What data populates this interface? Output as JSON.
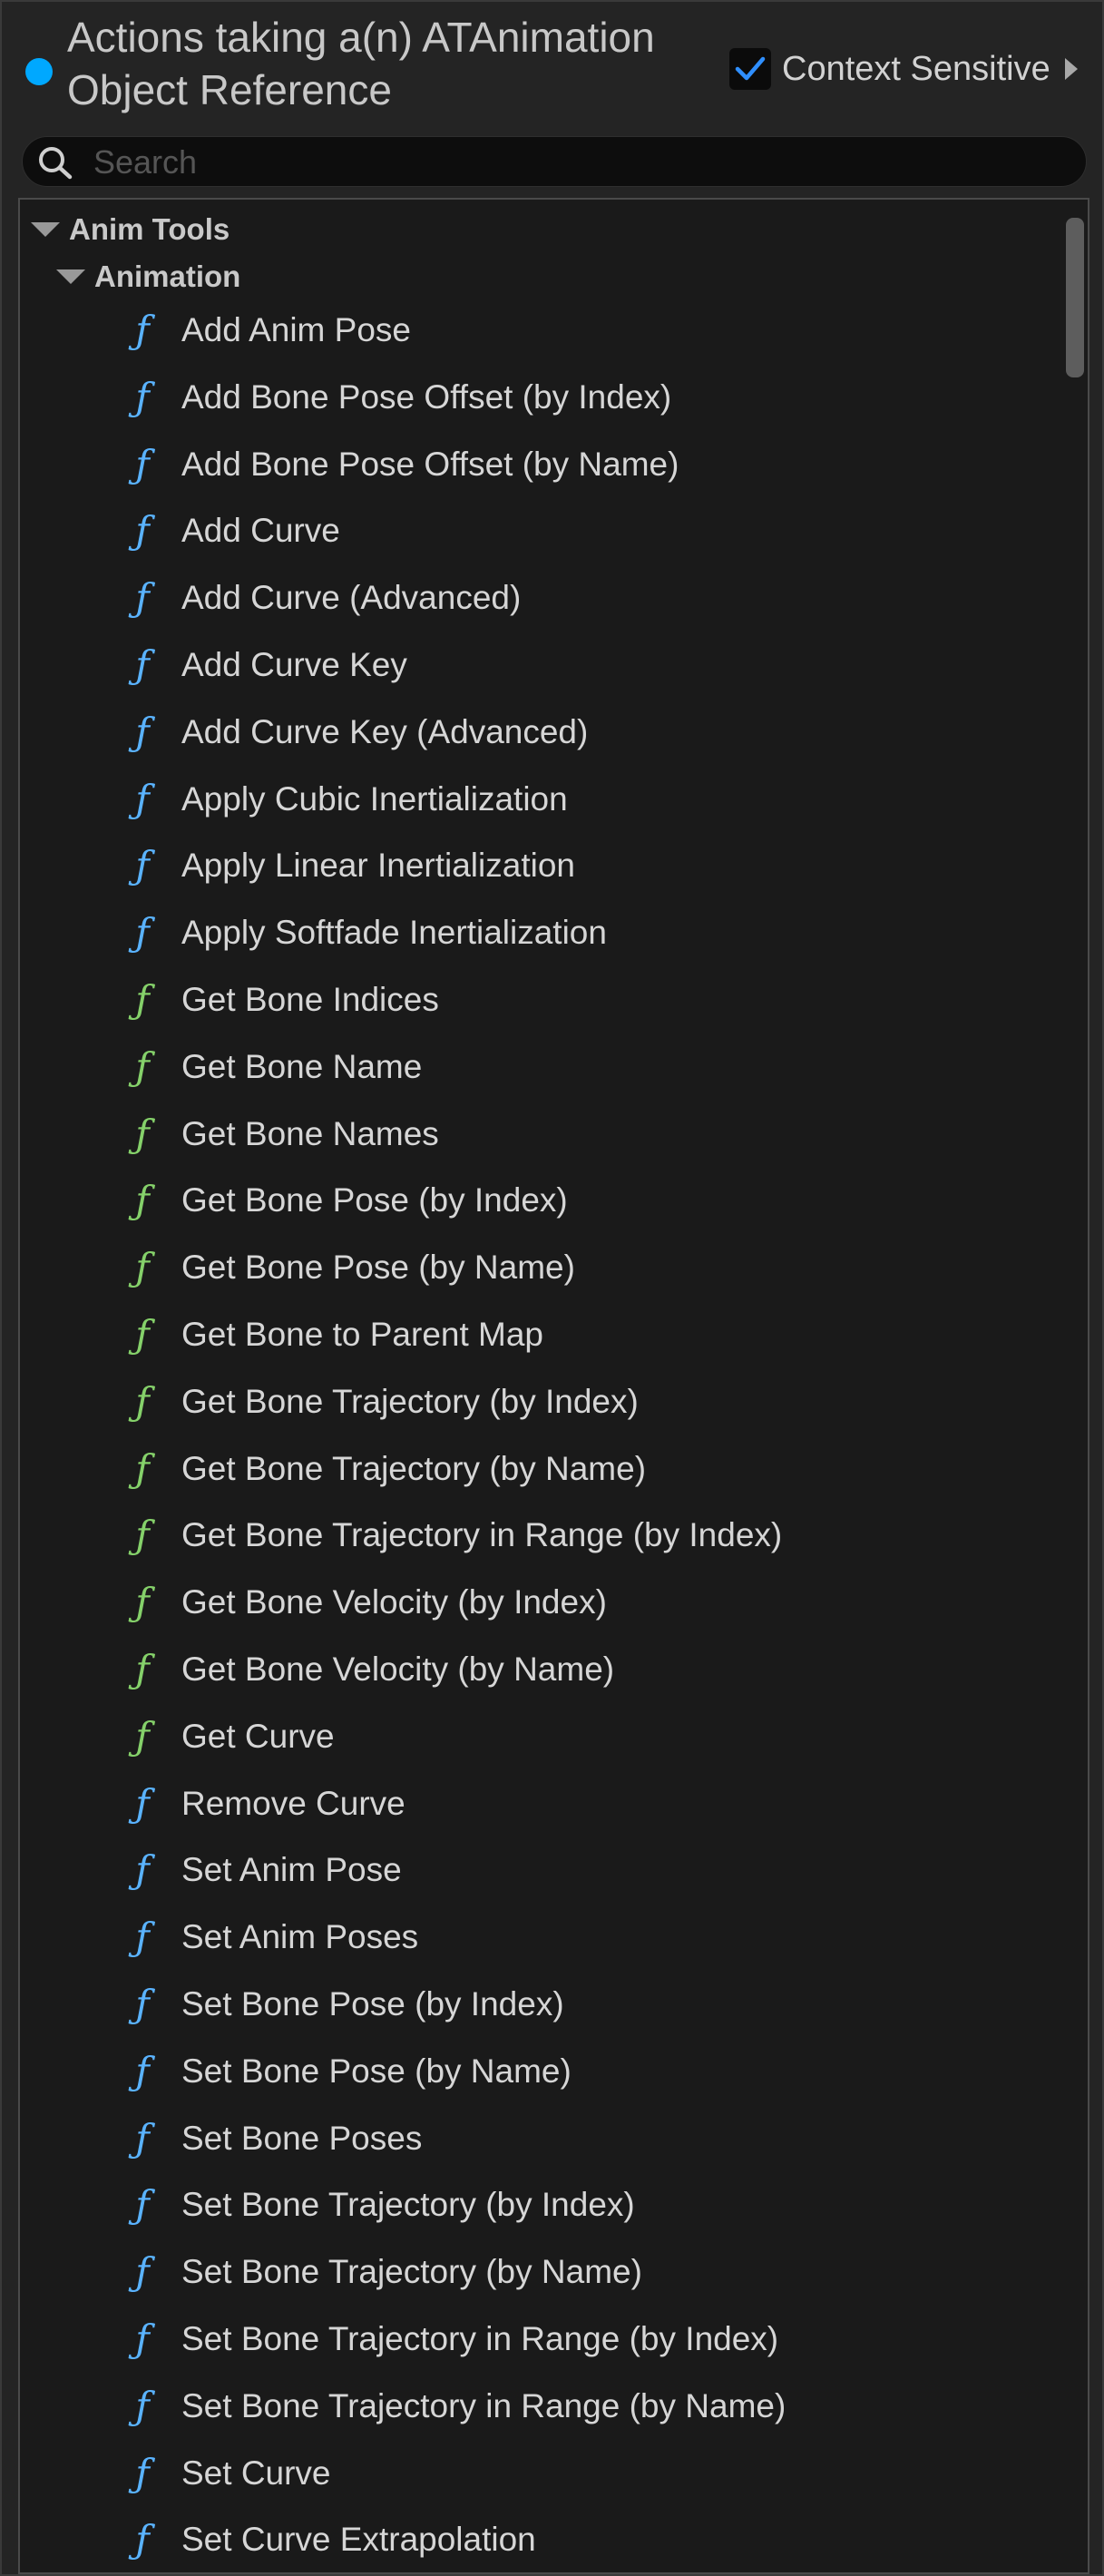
{
  "header": {
    "title_line1": "Actions taking a(n) ATAnimation",
    "title_line2": "Object Reference",
    "context_label": "Context Sensitive",
    "context_checked": true
  },
  "search": {
    "placeholder": "Search",
    "value": ""
  },
  "tree": {
    "root_label": "Anim Tools",
    "sub_label": "Animation",
    "items": [
      {
        "label": "Add Anim Pose",
        "kind": "blue"
      },
      {
        "label": "Add Bone Pose Offset (by Index)",
        "kind": "blue"
      },
      {
        "label": "Add Bone Pose Offset (by Name)",
        "kind": "blue"
      },
      {
        "label": "Add Curve",
        "kind": "blue"
      },
      {
        "label": "Add Curve (Advanced)",
        "kind": "blue"
      },
      {
        "label": "Add Curve Key",
        "kind": "blue"
      },
      {
        "label": "Add Curve Key (Advanced)",
        "kind": "blue"
      },
      {
        "label": "Apply Cubic Inertialization",
        "kind": "blue"
      },
      {
        "label": "Apply Linear Inertialization",
        "kind": "blue"
      },
      {
        "label": "Apply Softfade Inertialization",
        "kind": "blue"
      },
      {
        "label": "Get Bone Indices",
        "kind": "green"
      },
      {
        "label": "Get Bone Name",
        "kind": "green"
      },
      {
        "label": "Get Bone Names",
        "kind": "green"
      },
      {
        "label": "Get Bone Pose (by Index)",
        "kind": "green"
      },
      {
        "label": "Get Bone Pose (by Name)",
        "kind": "green"
      },
      {
        "label": "Get Bone to Parent Map",
        "kind": "green"
      },
      {
        "label": "Get Bone Trajectory (by Index)",
        "kind": "green"
      },
      {
        "label": "Get Bone Trajectory (by Name)",
        "kind": "green"
      },
      {
        "label": "Get Bone Trajectory in Range (by Index)",
        "kind": "green"
      },
      {
        "label": "Get Bone Velocity (by Index)",
        "kind": "green"
      },
      {
        "label": "Get Bone Velocity (by Name)",
        "kind": "green"
      },
      {
        "label": "Get Curve",
        "kind": "green"
      },
      {
        "label": "Remove Curve",
        "kind": "blue"
      },
      {
        "label": "Set Anim Pose",
        "kind": "blue"
      },
      {
        "label": "Set Anim Poses",
        "kind": "blue"
      },
      {
        "label": "Set Bone Pose (by Index)",
        "kind": "blue"
      },
      {
        "label": "Set Bone Pose (by Name)",
        "kind": "blue"
      },
      {
        "label": "Set Bone Poses",
        "kind": "blue"
      },
      {
        "label": "Set Bone Trajectory (by Index)",
        "kind": "blue"
      },
      {
        "label": "Set Bone Trajectory (by Name)",
        "kind": "blue"
      },
      {
        "label": "Set Bone Trajectory in Range (by Index)",
        "kind": "blue"
      },
      {
        "label": "Set Bone Trajectory in Range (by Name)",
        "kind": "blue"
      },
      {
        "label": "Set Curve",
        "kind": "blue"
      },
      {
        "label": "Set Curve Extrapolation",
        "kind": "blue"
      }
    ]
  },
  "icons": {
    "function_glyph": "ƒ"
  },
  "colors": {
    "accent_dot": "#00a8ff",
    "checkbox_check": "#2f8fff",
    "function_blue": "#5ab3ff",
    "function_green": "#85d16a"
  }
}
